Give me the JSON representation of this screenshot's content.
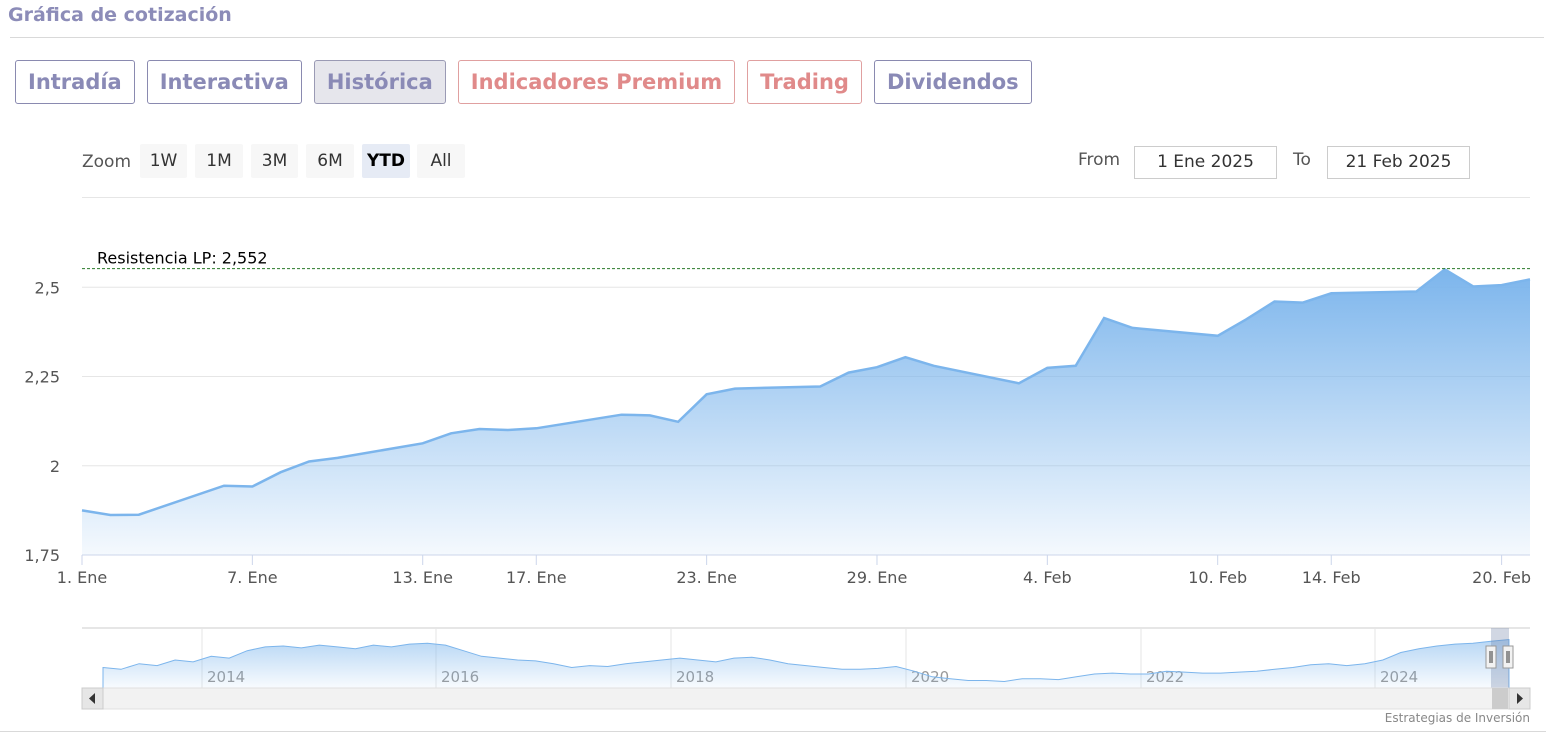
{
  "header": {
    "title": "Gráfica de cotización"
  },
  "tabs": [
    {
      "label": "Intradía",
      "style": "normal"
    },
    {
      "label": "Interactiva",
      "style": "normal"
    },
    {
      "label": "Histórica",
      "style": "active"
    },
    {
      "label": "Indicadores Premium",
      "style": "premium"
    },
    {
      "label": "Trading",
      "style": "premium"
    },
    {
      "label": "Dividendos",
      "style": "normal"
    }
  ],
  "zoom": {
    "label": "Zoom",
    "buttons": [
      "1W",
      "1M",
      "3M",
      "6M",
      "YTD",
      "All"
    ],
    "selected": "YTD"
  },
  "range": {
    "from_label": "From",
    "from_value": "1 Ene 2025",
    "to_label": "To",
    "to_value": "21 Feb 2025"
  },
  "credits": "Estrategias de Inversión",
  "colors": {
    "line": "#7cb5ec",
    "fill_top": "#7cb5ec",
    "resistance": "#2a7a2a",
    "brand": "#8c8cb8",
    "premium": "#e08a8a"
  },
  "chart_data": {
    "type": "area",
    "x_axis_type": "date",
    "y_ticks": [
      "1,75",
      "2",
      "2,25",
      "2,5"
    ],
    "ylim": [
      1.75,
      2.55
    ],
    "x_ticks": [
      "1. Ene",
      "7. Ene",
      "13. Ene",
      "17. Ene",
      "23. Ene",
      "29. Ene",
      "4. Feb",
      "10. Feb",
      "14. Feb",
      "20. Feb"
    ],
    "x_tick_dates": [
      "2025-01-01",
      "2025-01-07",
      "2025-01-13",
      "2025-01-17",
      "2025-01-23",
      "2025-01-29",
      "2025-02-04",
      "2025-02-10",
      "2025-02-14",
      "2025-02-20"
    ],
    "series": [
      {
        "x": [
          "2025-01-01",
          "2025-01-02",
          "2025-01-03",
          "2025-01-06",
          "2025-01-07",
          "2025-01-08",
          "2025-01-09",
          "2025-01-10",
          "2025-01-13",
          "2025-01-14",
          "2025-01-15",
          "2025-01-16",
          "2025-01-17",
          "2025-01-20",
          "2025-01-21",
          "2025-01-22",
          "2025-01-23",
          "2025-01-24",
          "2025-01-27",
          "2025-01-28",
          "2025-01-29",
          "2025-01-30",
          "2025-01-31",
          "2025-02-03",
          "2025-02-04",
          "2025-02-05",
          "2025-02-06",
          "2025-02-07",
          "2025-02-10",
          "2025-02-11",
          "2025-02-12",
          "2025-02-13",
          "2025-02-14",
          "2025-02-17",
          "2025-02-18",
          "2025-02-19",
          "2025-02-20",
          "2025-02-21"
        ],
        "y": [
          1.875,
          1.862,
          1.863,
          1.944,
          1.942,
          1.982,
          2.012,
          2.022,
          2.063,
          2.091,
          2.103,
          2.1,
          2.105,
          2.143,
          2.141,
          2.123,
          2.2,
          2.216,
          2.222,
          2.261,
          2.276,
          2.304,
          2.28,
          2.231,
          2.274,
          2.28,
          2.414,
          2.386,
          2.364,
          2.41,
          2.46,
          2.457,
          2.483,
          2.488,
          2.55,
          2.502,
          2.506,
          2.522
        ]
      }
    ],
    "annotations": [
      {
        "label": "Resistencia LP: 2,552",
        "value": 2.552
      }
    ],
    "navigator": {
      "year_labels": [
        "2014",
        "2016",
        "2018",
        "2020",
        "2022",
        "2024"
      ],
      "values": [
        1.62,
        1.6,
        1.66,
        1.64,
        1.7,
        1.68,
        1.74,
        1.72,
        1.8,
        1.84,
        1.85,
        1.83,
        1.86,
        1.84,
        1.82,
        1.86,
        1.84,
        1.87,
        1.88,
        1.86,
        1.8,
        1.74,
        1.72,
        1.7,
        1.69,
        1.66,
        1.62,
        1.64,
        1.63,
        1.66,
        1.68,
        1.7,
        1.72,
        1.7,
        1.68,
        1.72,
        1.73,
        1.7,
        1.66,
        1.64,
        1.62,
        1.6,
        1.6,
        1.61,
        1.63,
        1.58,
        1.52,
        1.5,
        1.48,
        1.48,
        1.47,
        1.5,
        1.5,
        1.49,
        1.52,
        1.55,
        1.56,
        1.55,
        1.55,
        1.58,
        1.57,
        1.56,
        1.56,
        1.57,
        1.58,
        1.6,
        1.62,
        1.65,
        1.66,
        1.64,
        1.66,
        1.7,
        1.78,
        1.82,
        1.85,
        1.87,
        1.88,
        1.9,
        1.92
      ]
    }
  }
}
